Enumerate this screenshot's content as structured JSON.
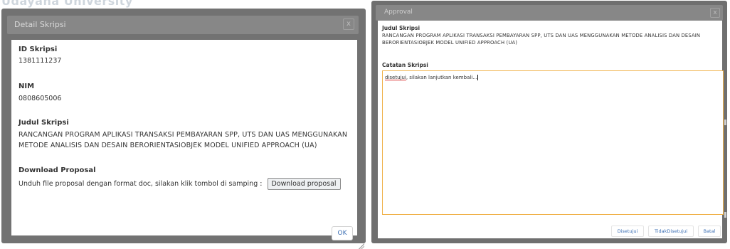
{
  "background": {
    "text": "Udayana University"
  },
  "left_dialog": {
    "title": "Detail Skripsi",
    "close_label": "x",
    "fields": {
      "id_label": "ID Skripsi",
      "id_value": "1381111237",
      "nim_label": "NIM",
      "nim_value": "0808605006",
      "judul_label": "Judul Skripsi",
      "judul_value": "RANCANGAN PROGRAM APLIKASI TRANSAKSI PEMBAYARAN SPP, UTS DAN UAS MENGGUNAKAN METODE ANALISIS DAN DESAIN BERORIENTASIOBJEK MODEL UNIFIED APPROACH (UA)",
      "download_label": "Download Proposal",
      "download_text": "Unduh file proposal dengan format doc, silakan klik tombol di samping :",
      "download_button": "Download proposal"
    },
    "ok_label": "OK"
  },
  "right_dialog": {
    "title": "Approval",
    "close_label": "x",
    "judul_label": "Judul Skripsi",
    "judul_value": "RANCANGAN PROGRAM APLIKASI TRANSAKSI PEMBAYARAN SPP, UTS DAN UAS MENGGUNAKAN METODE ANALISIS DAN DESAIN BERORIENTASIOBJEK MODEL UNIFIED APPROACH (UA)",
    "catatan_label": "Catatan Skripsi",
    "catatan_value_a": "disetujui",
    "catatan_value_b": ", silakan lanjutkan kembali...",
    "buttons": {
      "approve": "Disetujui",
      "reject": "TidakDisetujui",
      "cancel": "Batal"
    }
  },
  "colors": {
    "overlay": "#727272",
    "titlebar": "#878787",
    "link_blue": "#3c6fb4",
    "focus_border": "#f0b24a"
  }
}
